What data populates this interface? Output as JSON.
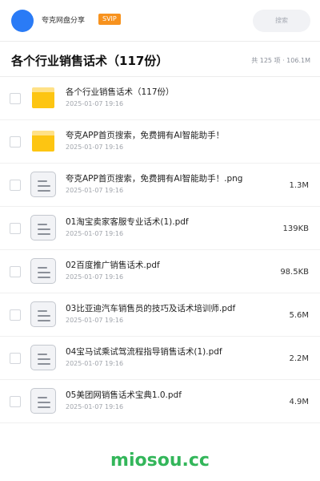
{
  "header": {
    "brand": "夸克网盘分享",
    "badge": "SVIP",
    "search_placeholder": "搜索"
  },
  "title_bar": {
    "title": "各个行业销售话术（117份）",
    "stats": "共 125 项 · 106.1M"
  },
  "files": [
    {
      "name": "各个行业销售话术（117份）",
      "date": "2025-01-07 19:16",
      "size": "",
      "icon": "folder-icon"
    },
    {
      "name": "夸克APP首页搜索，免费拥有AI智能助手！",
      "date": "2025-01-07 19:16",
      "size": "",
      "icon": "folder-icon"
    },
    {
      "name": "夸克APP首页搜索，免费拥有AI智能助手！.png",
      "date": "2025-01-07 19:16",
      "size": "1.3M",
      "icon": "document-icon"
    },
    {
      "name": "01淘宝卖家客服专业话术(1).pdf",
      "date": "2025-01-07 19:16",
      "size": "139KB",
      "icon": "document-icon"
    },
    {
      "name": "02百度推广销售话术.pdf",
      "date": "2025-01-07 19:16",
      "size": "98.5KB",
      "icon": "document-icon"
    },
    {
      "name": "03比亚迪汽车销售员的技巧及话术培训师.pdf",
      "date": "2025-01-07 19:16",
      "size": "5.6M",
      "icon": "document-icon"
    },
    {
      "name": "04宝马试乘试驾流程指导销售话术(1).pdf",
      "date": "2025-01-07 19:16",
      "size": "2.2M",
      "icon": "document-icon"
    },
    {
      "name": "05美团网销售话术宝典1.0.pdf",
      "date": "2025-01-07 19:16",
      "size": "4.9M",
      "icon": "document-icon"
    }
  ],
  "watermark": "miosou.cc",
  "colors": {
    "accent_blue": "#2a7bf6",
    "svip_orange": "#f7921e",
    "folder_yellow": "#fdc512",
    "watermark_green": "#33b65a"
  }
}
